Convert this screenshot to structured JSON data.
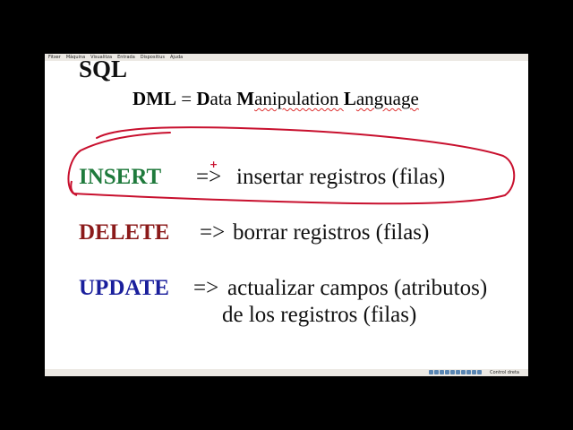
{
  "menu": [
    "Fitxer",
    "Màquina",
    "Visualitza",
    "Entrada",
    "Dispositius",
    "Ajuda"
  ],
  "slide": {
    "title": "SQL",
    "subtitle": {
      "dml": "DML",
      "eq": " = ",
      "d": "D",
      "ata": "ata ",
      "m": "M",
      "anipulation": "anipulation ",
      "l": "L",
      "anguage": "anguage"
    },
    "rows": [
      {
        "keyword": "INSERT",
        "arrow": "=>",
        "text": "insertar registros (filas)"
      },
      {
        "keyword": "DELETE",
        "arrow": "=>",
        "text": "borrar registros (filas)"
      },
      {
        "keyword": "UPDATE",
        "arrow": "=>",
        "text": "actualizar campos (atributos)",
        "text2": "de los registros (filas)"
      }
    ],
    "annotation_mark": "+"
  },
  "status": {
    "host_key": "Control dreta"
  },
  "colors": {
    "insert": "#1f7a3c",
    "delete": "#8b1a1a",
    "update": "#1a1f9c",
    "annotation": "#c8102e"
  }
}
